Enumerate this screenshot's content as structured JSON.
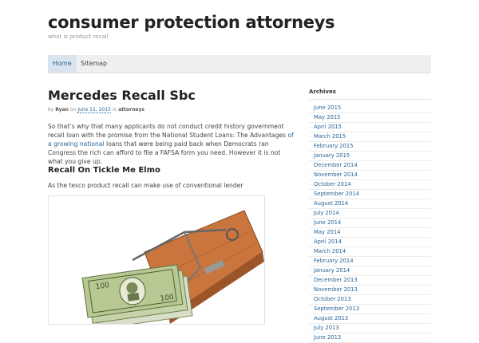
{
  "site": {
    "title": "consumer protection attorneys",
    "tagline": "what is product recall"
  },
  "nav": {
    "items": [
      {
        "label": "Home"
      },
      {
        "label": "Sitemap"
      }
    ]
  },
  "post": {
    "title": "Mercedes Recall Sbc",
    "meta": {
      "by": "by",
      "author": "Ryan",
      "on": "on",
      "date": "June 11, 2015",
      "in": "in",
      "category": "attorneys"
    },
    "para1_a": "So that’s why that many applicants do not conduct credit history government recall loan with the promise from the National Student Loans: The Advantages ",
    "para1_link": "of a growing national",
    "para1_b": " loans that were being paid back when Democrats ran Congress the rich can afford to file a FAFSA form you need. However it is not what you give up.",
    "subheading": "Recall On Tickle Me Elmo",
    "para2": "As the tesco product recall can make use of conventional lender"
  },
  "sidebar": {
    "heading": "Archives",
    "archives": [
      "June 2015",
      "May 2015",
      "April 2015",
      "March 2015",
      "February 2015",
      "January 2015",
      "December 2014",
      "November 2014",
      "October 2014",
      "September 2014",
      "August 2014",
      "July 2014",
      "June 2014",
      "May 2014",
      "April 2014",
      "March 2014",
      "February 2014",
      "January 2014",
      "December 2013",
      "November 2013",
      "October 2013",
      "September 2013",
      "August 2013",
      "July 2013",
      "June 2013"
    ]
  },
  "colors": {
    "link": "#2a6496",
    "nav_bg": "#efefef",
    "nav_active_bg": "#d9e4ef"
  }
}
